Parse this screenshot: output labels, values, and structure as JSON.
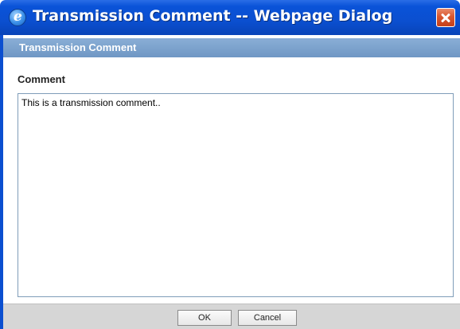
{
  "window": {
    "title": "Transmission Comment -- Webpage Dialog"
  },
  "section": {
    "header": "Transmission Comment"
  },
  "comment": {
    "label": "Comment",
    "value": "This is a transmission comment.."
  },
  "buttons": {
    "ok_label": "OK",
    "cancel_label": "Cancel"
  },
  "colors": {
    "titlebar": "#0b4fd0",
    "section_header": "#7a9fca",
    "close_button": "#d9572f",
    "button_bar": "#d6d6d6"
  },
  "icons": {
    "window_icon": "internet-explorer-icon",
    "close_icon": "close-icon"
  }
}
